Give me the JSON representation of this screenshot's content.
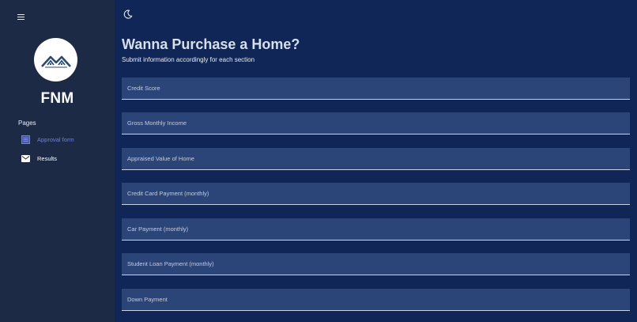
{
  "brand": {
    "name": "FNM"
  },
  "sidebar": {
    "section_label": "Pages",
    "items": [
      {
        "label": "Approval form",
        "active": true
      },
      {
        "label": "Results",
        "active": false
      }
    ]
  },
  "header": {
    "title": "Wanna Purchase a Home?",
    "subtitle": "Submit information accordingly for each section"
  },
  "form": {
    "fields": [
      {
        "placeholder": "Credit Score",
        "value": ""
      },
      {
        "placeholder": "Gross Monthly Income",
        "value": ""
      },
      {
        "placeholder": "Appraised Value of Home",
        "value": ""
      },
      {
        "placeholder": "Credit Card Payment (monthly)",
        "value": ""
      },
      {
        "placeholder": "Car Payment (monthly)",
        "value": ""
      },
      {
        "placeholder": "Student Loan Payment (monthly)",
        "value": ""
      },
      {
        "placeholder": "Down Payment",
        "value": ""
      }
    ]
  },
  "icons": {
    "menu": "hamburger-menu-icon",
    "theme": "moon-icon",
    "approval": "form-icon",
    "results": "mail-icon"
  },
  "colors": {
    "background": "#0f2657",
    "sidebar": "#1d2a45",
    "field": "#2c4578",
    "accent": "#6f7fe8"
  }
}
